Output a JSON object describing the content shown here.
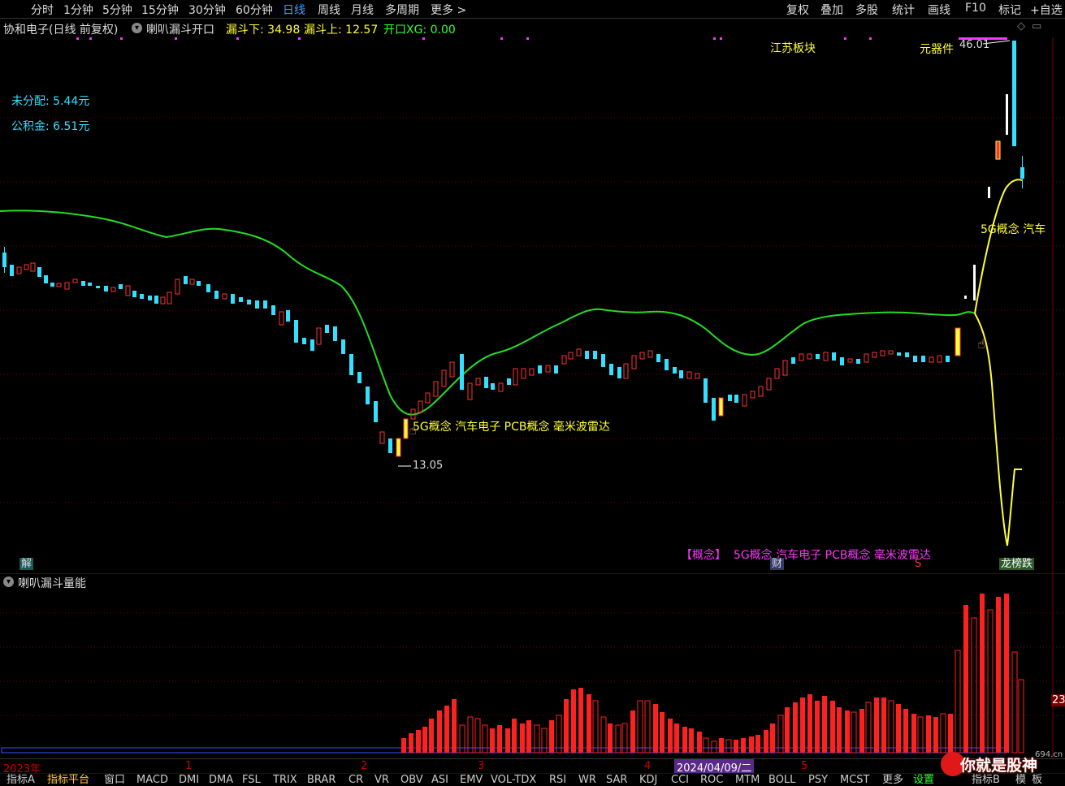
{
  "toolbar": {
    "periods": [
      "分时",
      "1分钟",
      "5分钟",
      "15分钟",
      "30分钟",
      "60分钟",
      "日线",
      "周线",
      "月线",
      "多周期",
      "更多 >"
    ],
    "active_period": "日线",
    "right_items": [
      "复权",
      "叠加",
      "多股",
      "统计",
      "画线",
      "F10",
      "标记",
      "+自选"
    ]
  },
  "info": {
    "stock_name": "协和电子(日线 前复权)",
    "indicator_name": "喇叭漏斗开口",
    "lower_label": "漏斗下: 34.98",
    "upper_label": "漏斗上: 12.57",
    "open_label": "开口XG: 0.00"
  },
  "chart": {
    "undistributed": "未分配: 5.44元",
    "reserve_fund": "公积金: 6.51元",
    "high_label": "46.01",
    "low_label": "13.05",
    "sector_label": "江苏板块",
    "component_label": "元器件",
    "concept_mid": "5G概念 汽车电子 PCB概念 毫米波雷达",
    "concept_right": "5G概念 汽车",
    "concept_bottom_tag": "【概念】",
    "concept_bottom": "5G概念 汽车电子 PCB概念 毫米波雷达",
    "jie_badge": "解",
    "cai_badge": "财",
    "s_badge": "S",
    "bangdie_badge": "龙榜跌",
    "colors": {
      "up": "#ff3333",
      "down": "#33e0ff",
      "ma": "#22dd22",
      "yellow": "#ffff33",
      "magenta": "#ff33ff"
    }
  },
  "sub": {
    "title": "喇叭漏斗量能",
    "right_value": "23"
  },
  "dates": {
    "year": "2023年",
    "m1": "1",
    "m2": "2",
    "m3": "3",
    "m4": "4",
    "cursor_date": "2024/04/09/二",
    "m5": "5"
  },
  "tabs": {
    "items": [
      "指标A",
      "指标平台",
      "窗口",
      "MACD",
      "DMI",
      "DMA",
      "FSL",
      "TRIX",
      "BRAR",
      "CR",
      "VR",
      "OBV",
      "ASI",
      "EMV",
      "VOL-TDX",
      "RSI",
      "WR",
      "SAR",
      "KDJ",
      "CCI",
      "ROC",
      "MTM",
      "BOLL",
      "PSY",
      "MCST",
      "更多",
      "设置"
    ],
    "right": [
      "指标B",
      "模",
      "板"
    ]
  },
  "watermark": {
    "text": "你就是股神",
    "site": "694.cn"
  }
}
